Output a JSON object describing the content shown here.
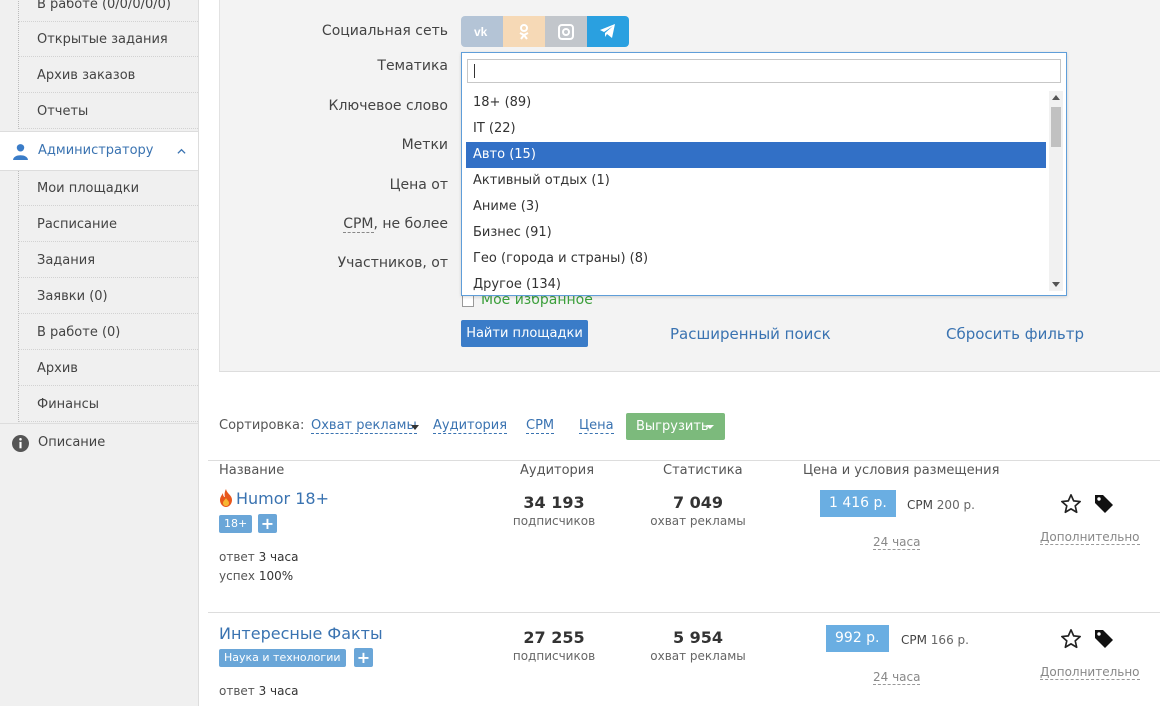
{
  "sidebar": {
    "items": [
      {
        "label": "В работе (0/0/0/0/0)"
      },
      {
        "label": "Открытые задания"
      },
      {
        "label": "Архив заказов"
      },
      {
        "label": "Отчеты"
      }
    ],
    "admin": {
      "label": "Администратору",
      "items": [
        {
          "label": "Мои площадки"
        },
        {
          "label": "Расписание"
        },
        {
          "label": "Задания"
        },
        {
          "label": "Заявки (0)"
        },
        {
          "label": "В работе (0)"
        },
        {
          "label": "Архив"
        },
        {
          "label": "Финансы"
        }
      ]
    },
    "info": {
      "label": "Описание"
    }
  },
  "filter": {
    "labels": {
      "social": "Социальная сеть",
      "topic": "Тематика",
      "keyword": "Ключевое слово",
      "tags": "Метки",
      "price_from": "Цена от",
      "cpm_prefix": "CPM",
      "cpm_suffix": ", не более",
      "members_from": "Участников, от"
    },
    "networks": [
      "vk-icon",
      "odnoklassniki-icon",
      "instagram-icon",
      "telegram-icon"
    ],
    "topic_options": [
      {
        "label": "18+ (89)"
      },
      {
        "label": "IT (22)"
      },
      {
        "label": "Авто (15)"
      },
      {
        "label": "Активный отдых (1)"
      },
      {
        "label": "Аниме (3)"
      },
      {
        "label": "Бизнес (91)"
      },
      {
        "label": "Гео (города и страны) (8)"
      },
      {
        "label": "Другое (134)"
      }
    ],
    "selected_topic": "Авто (15)",
    "favorites_label": "Мое избранное",
    "find_button": "Найти площадки",
    "advanced_link": "Расширенный поиск",
    "reset_link": "Сбросить фильтр"
  },
  "sort": {
    "label": "Сортировка:",
    "options": [
      {
        "label": "Охват рекламы"
      },
      {
        "label": "Аудитория"
      },
      {
        "label": "CPM"
      },
      {
        "label": "Цена"
      }
    ],
    "export_button": "Выгрузить"
  },
  "table": {
    "headers": {
      "name": "Название",
      "audience": "Аудитория",
      "stats": "Статистика",
      "price": "Цена и условия размещения"
    },
    "rows": [
      {
        "name": "Humor 18+",
        "tag": "18+",
        "reply_label": "ответ",
        "reply_value": "3 часа",
        "success_label": "успех",
        "success_value": "100%",
        "audience": "34 193",
        "audience_unit": "подписчиков",
        "reach": "7 049",
        "reach_unit": "охват рекламы",
        "price": "1 416 р.",
        "cpm_label": "CPM",
        "cpm_value": "200 р.",
        "term": "24 часа",
        "more": "Дополнительно"
      },
      {
        "name": "Интересные Факты",
        "tag": "Наука и технологии",
        "reply_label": "ответ",
        "reply_value": "3 часа",
        "audience": "27 255",
        "audience_unit": "подписчиков",
        "reach": "5 954",
        "reach_unit": "охват рекламы",
        "price": "992 р.",
        "cpm_label": "CPM",
        "cpm_value": "166 р.",
        "term": "24 часа",
        "more": "Дополнительно"
      }
    ]
  },
  "colors": {
    "link": "#3a73b1",
    "primary_button": "#3a7cc8",
    "export_button": "#7cba7c",
    "selected_option": "#3270c6",
    "telegram": "#2aa0e0"
  }
}
